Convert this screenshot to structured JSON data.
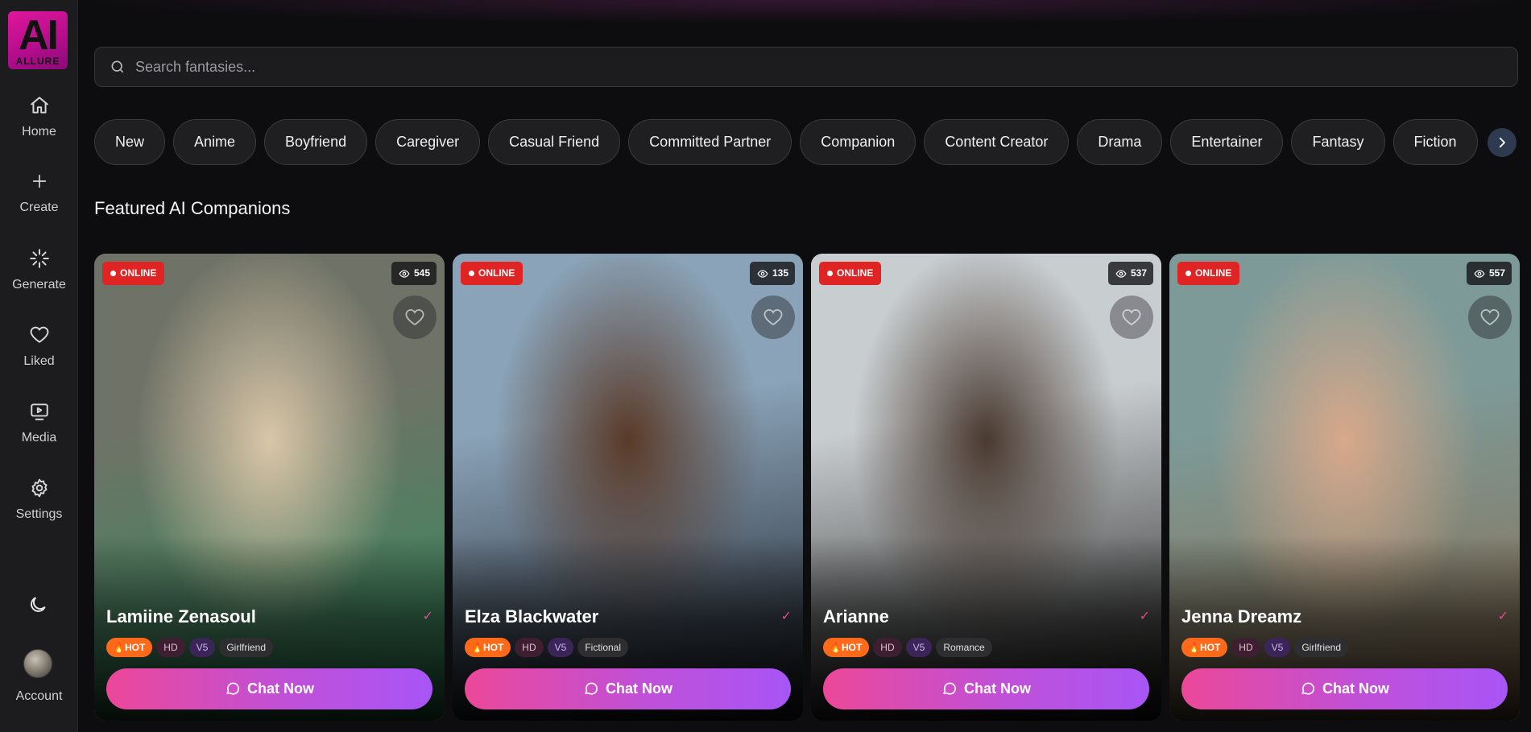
{
  "app": {
    "logo_text": "AI",
    "logo_word": "ALLURE"
  },
  "sidebar": {
    "items": [
      {
        "label": "Home",
        "icon": "home-icon"
      },
      {
        "label": "Create",
        "icon": "plus-icon"
      },
      {
        "label": "Generate",
        "icon": "sparkle-icon"
      },
      {
        "label": "Liked",
        "icon": "heart-icon"
      },
      {
        "label": "Media",
        "icon": "media-icon"
      },
      {
        "label": "Settings",
        "icon": "gear-icon"
      }
    ],
    "theme_toggle_icon": "moon-icon",
    "account_label": "Account"
  },
  "search": {
    "placeholder": "Search fantasies...",
    "value": ""
  },
  "categories": [
    "New",
    "Anime",
    "Boyfriend",
    "Caregiver",
    "Casual Friend",
    "Committed Partner",
    "Companion",
    "Content Creator",
    "Drama",
    "Entertainer",
    "Fantasy",
    "Fiction"
  ],
  "section_title": "Featured AI Companions",
  "cards": [
    {
      "name": "Lamiine Zenasoul",
      "status": "ONLINE",
      "views": "545",
      "badge_hot": "HOT",
      "badge_hd": "HD",
      "badge_version": "V5",
      "category": "Girlfriend",
      "cta": "Chat Now",
      "verified_mark": "✓",
      "photo_colors": [
        "#6f7367",
        "#d9c6a8",
        "#2d8c5a"
      ]
    },
    {
      "name": "Elza Blackwater",
      "status": "ONLINE",
      "views": "135",
      "badge_hot": "HOT",
      "badge_hd": "HD",
      "badge_version": "V5",
      "category": "Fictional",
      "cta": "Chat Now",
      "verified_mark": "✓",
      "photo_colors": [
        "#8aa3b8",
        "#5a3a28",
        "#1a1c24"
      ]
    },
    {
      "name": "Arianne",
      "status": "ONLINE",
      "views": "537",
      "badge_hot": "HOT",
      "badge_hd": "HD",
      "badge_version": "V5",
      "category": "Romance",
      "cta": "Chat Now",
      "verified_mark": "✓",
      "photo_colors": [
        "#c8cdd0",
        "#4a3a30",
        "#1b1917"
      ]
    },
    {
      "name": "Jenna Dreamz",
      "status": "ONLINE",
      "views": "557",
      "badge_hot": "HOT",
      "badge_hd": "HD",
      "badge_version": "V5",
      "category": "Girlfriend",
      "cta": "Chat Now",
      "verified_mark": "✓",
      "photo_colors": [
        "#7d9a98",
        "#d8a88a",
        "#8a6a4a"
      ]
    }
  ],
  "colors": {
    "accent_pink": "#ec4899",
    "accent_purple": "#a855f7",
    "online_red": "#e02424",
    "hot_orange": "#ff6a1a"
  }
}
